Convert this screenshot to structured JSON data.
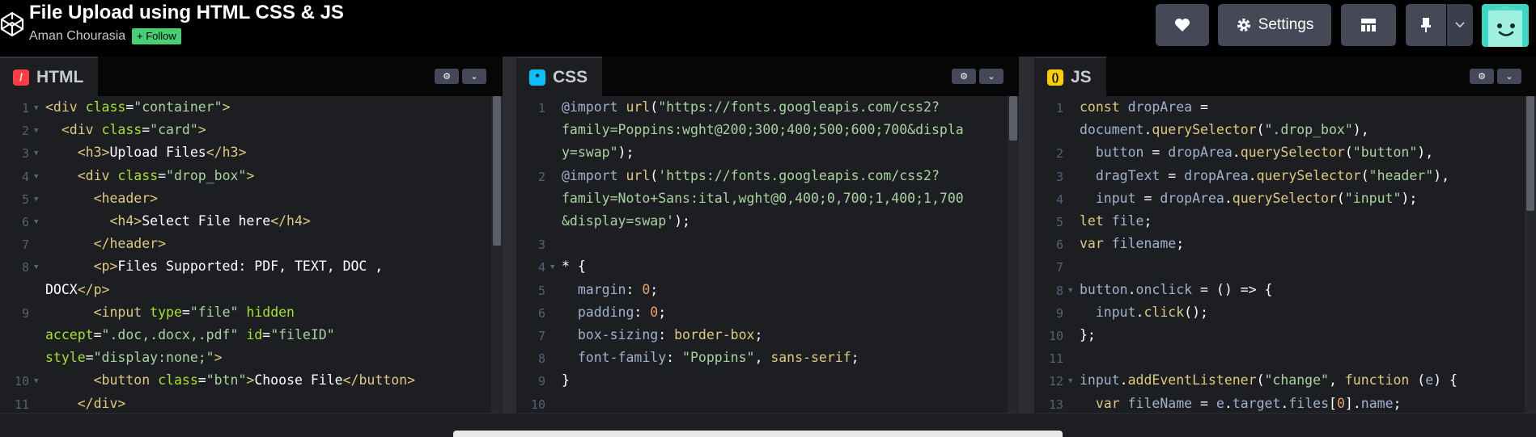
{
  "header": {
    "title": "File Upload using HTML CSS & JS",
    "author": "Aman Chourasia",
    "follow_label": "+ Follow",
    "settings_label": "Settings",
    "icons": [
      "codepen-logo-icon",
      "heart-icon",
      "gear-icon",
      "layout-icon",
      "pin-icon",
      "chevron-down-icon",
      "avatar"
    ]
  },
  "panels": {
    "html": {
      "label": "HTML",
      "lines": [
        {
          "n": "1",
          "fold": true,
          "segs": [
            [
              "t-tag",
              "<div "
            ],
            [
              "t-attr",
              "class"
            ],
            [
              "",
              "="
            ],
            [
              "t-str",
              "\"container\""
            ],
            [
              "t-tag",
              ">"
            ]
          ]
        },
        {
          "n": "2",
          "fold": true,
          "segs": [
            [
              "",
              "  "
            ],
            [
              "t-tag",
              "<div "
            ],
            [
              "t-attr",
              "class"
            ],
            [
              "",
              "="
            ],
            [
              "t-str",
              "\"card\""
            ],
            [
              "t-tag",
              ">"
            ]
          ]
        },
        {
          "n": "3",
          "fold": true,
          "segs": [
            [
              "",
              "    "
            ],
            [
              "t-tag",
              "<h3>"
            ],
            [
              "",
              "Upload Files"
            ],
            [
              "t-tag",
              "</h3>"
            ]
          ]
        },
        {
          "n": "4",
          "fold": true,
          "segs": [
            [
              "",
              "    "
            ],
            [
              "t-tag",
              "<div "
            ],
            [
              "t-attr",
              "class"
            ],
            [
              "",
              "="
            ],
            [
              "t-str",
              "\"drop_box\""
            ],
            [
              "t-tag",
              ">"
            ]
          ]
        },
        {
          "n": "5",
          "fold": true,
          "segs": [
            [
              "",
              "      "
            ],
            [
              "t-tag",
              "<header>"
            ]
          ]
        },
        {
          "n": "6",
          "fold": true,
          "segs": [
            [
              "",
              "        "
            ],
            [
              "t-tag",
              "<h4>"
            ],
            [
              "",
              "Select File here"
            ],
            [
              "t-tag",
              "</h4>"
            ]
          ]
        },
        {
          "n": "7",
          "fold": false,
          "segs": [
            [
              "",
              "      "
            ],
            [
              "t-tag",
              "</header>"
            ]
          ]
        },
        {
          "n": "8",
          "fold": true,
          "segs": [
            [
              "",
              "      "
            ],
            [
              "t-tag",
              "<p>"
            ],
            [
              "",
              "Files Supported: PDF, TEXT, DOC ,"
            ]
          ]
        },
        {
          "n": "",
          "fold": false,
          "segs": [
            [
              "",
              "DOCX"
            ],
            [
              "t-tag",
              "</p>"
            ]
          ]
        },
        {
          "n": "9",
          "fold": false,
          "segs": [
            [
              "",
              "      "
            ],
            [
              "t-tag",
              "<input "
            ],
            [
              "t-attr",
              "type"
            ],
            [
              "",
              "="
            ],
            [
              "t-str",
              "\"file\""
            ],
            [
              "",
              ""
            ],
            [
              "t-attr",
              " hidden"
            ]
          ]
        },
        {
          "n": "",
          "fold": false,
          "segs": [
            [
              "t-attr",
              "accept"
            ],
            [
              "",
              "="
            ],
            [
              "t-str",
              "\".doc,.docx,.pdf\""
            ],
            [
              "t-attr",
              " id"
            ],
            [
              "",
              "="
            ],
            [
              "t-str",
              "\"fileID\""
            ]
          ]
        },
        {
          "n": "",
          "fold": false,
          "segs": [
            [
              "t-attr",
              "style"
            ],
            [
              "",
              "="
            ],
            [
              "t-str",
              "\"display:none;\""
            ],
            [
              "t-tag",
              ">"
            ]
          ]
        },
        {
          "n": "10",
          "fold": true,
          "segs": [
            [
              "",
              "      "
            ],
            [
              "t-tag",
              "<button "
            ],
            [
              "t-attr",
              "class"
            ],
            [
              "",
              "="
            ],
            [
              "t-str",
              "\"btn\""
            ],
            [
              "t-tag",
              ">"
            ],
            [
              "",
              "Choose File"
            ],
            [
              "t-tag",
              "</button>"
            ]
          ]
        },
        {
          "n": "11",
          "fold": false,
          "segs": [
            [
              "",
              "    "
            ],
            [
              "t-tag",
              "</div>"
            ]
          ]
        }
      ]
    },
    "css": {
      "label": "CSS",
      "lines": [
        {
          "n": "1",
          "fold": false,
          "segs": [
            [
              "t-at",
              "@import "
            ],
            [
              "t-fn",
              "url"
            ],
            [
              "",
              "("
            ],
            [
              "t-str",
              "\"https://fonts.googleapis.com/css2?"
            ]
          ]
        },
        {
          "n": "",
          "fold": false,
          "segs": [
            [
              "t-str",
              "family=Poppins:wght@200;300;400;500;600;700&displa"
            ]
          ]
        },
        {
          "n": "",
          "fold": false,
          "segs": [
            [
              "t-str",
              "y=swap\""
            ],
            [
              "",
              ");"
            ]
          ]
        },
        {
          "n": "2",
          "fold": false,
          "segs": [
            [
              "t-at",
              "@import "
            ],
            [
              "t-fn",
              "url"
            ],
            [
              "",
              "("
            ],
            [
              "t-str",
              "'https://fonts.googleapis.com/css2?"
            ]
          ]
        },
        {
          "n": "",
          "fold": false,
          "segs": [
            [
              "t-str",
              "family=Noto+Sans:ital,wght@0,400;0,700;1,400;1,700"
            ]
          ]
        },
        {
          "n": "",
          "fold": false,
          "segs": [
            [
              "t-str",
              "&display=swap'"
            ],
            [
              "",
              ");"
            ]
          ]
        },
        {
          "n": "3",
          "fold": false,
          "segs": []
        },
        {
          "n": "4",
          "fold": true,
          "segs": [
            [
              "",
              "* {"
            ]
          ]
        },
        {
          "n": "5",
          "fold": false,
          "segs": [
            [
              "",
              "  "
            ],
            [
              "t-prop",
              "margin"
            ],
            [
              "",
              ": "
            ],
            [
              "t-num",
              "0"
            ],
            [
              "",
              ";"
            ]
          ]
        },
        {
          "n": "6",
          "fold": false,
          "segs": [
            [
              "",
              "  "
            ],
            [
              "t-prop",
              "padding"
            ],
            [
              "",
              ": "
            ],
            [
              "t-num",
              "0"
            ],
            [
              "",
              ";"
            ]
          ]
        },
        {
          "n": "7",
          "fold": false,
          "segs": [
            [
              "",
              "  "
            ],
            [
              "t-prop",
              "box-sizing"
            ],
            [
              "",
              ": "
            ],
            [
              "t-val",
              "border-box"
            ],
            [
              "",
              ";"
            ]
          ]
        },
        {
          "n": "8",
          "fold": false,
          "segs": [
            [
              "",
              "  "
            ],
            [
              "t-prop",
              "font-family"
            ],
            [
              "",
              ": "
            ],
            [
              "t-str",
              "\"Poppins\""
            ],
            [
              "",
              ", "
            ],
            [
              "t-val",
              "sans-serif"
            ],
            [
              "",
              ";"
            ]
          ]
        },
        {
          "n": "9",
          "fold": false,
          "segs": [
            [
              "",
              "}"
            ]
          ]
        },
        {
          "n": "10",
          "fold": false,
          "segs": []
        }
      ]
    },
    "js": {
      "label": "JS",
      "lines": [
        {
          "n": "1",
          "fold": false,
          "segs": [
            [
              "t-kw",
              "const "
            ],
            [
              "t-var",
              "dropArea"
            ],
            [
              "",
              " ="
            ]
          ]
        },
        {
          "n": "",
          "fold": false,
          "segs": [
            [
              "t-var",
              "document"
            ],
            [
              "",
              "."
            ],
            [
              "t-fn",
              "querySelector"
            ],
            [
              "",
              "("
            ],
            [
              "t-str",
              "\".drop_box\""
            ],
            [
              "",
              "),"
            ]
          ]
        },
        {
          "n": "2",
          "fold": false,
          "segs": [
            [
              "",
              "  "
            ],
            [
              "t-var",
              "button"
            ],
            [
              "",
              " = "
            ],
            [
              "t-var",
              "dropArea"
            ],
            [
              "",
              "."
            ],
            [
              "t-fn",
              "querySelector"
            ],
            [
              "",
              "("
            ],
            [
              "t-str",
              "\"button\""
            ],
            [
              "",
              "),"
            ]
          ]
        },
        {
          "n": "3",
          "fold": false,
          "segs": [
            [
              "",
              "  "
            ],
            [
              "t-var",
              "dragText"
            ],
            [
              "",
              " = "
            ],
            [
              "t-var",
              "dropArea"
            ],
            [
              "",
              "."
            ],
            [
              "t-fn",
              "querySelector"
            ],
            [
              "",
              "("
            ],
            [
              "t-str",
              "\"header\""
            ],
            [
              "",
              "),"
            ]
          ]
        },
        {
          "n": "4",
          "fold": false,
          "segs": [
            [
              "",
              "  "
            ],
            [
              "t-var",
              "input"
            ],
            [
              "",
              " = "
            ],
            [
              "t-var",
              "dropArea"
            ],
            [
              "",
              "."
            ],
            [
              "t-fn",
              "querySelector"
            ],
            [
              "",
              "("
            ],
            [
              "t-str",
              "\"input\""
            ],
            [
              "",
              ");"
            ]
          ]
        },
        {
          "n": "5",
          "fold": false,
          "segs": [
            [
              "t-kw",
              "let "
            ],
            [
              "t-var",
              "file"
            ],
            [
              "",
              ";"
            ]
          ]
        },
        {
          "n": "6",
          "fold": false,
          "segs": [
            [
              "t-kw",
              "var "
            ],
            [
              "t-var",
              "filename"
            ],
            [
              "",
              ";"
            ]
          ]
        },
        {
          "n": "7",
          "fold": false,
          "segs": []
        },
        {
          "n": "8",
          "fold": true,
          "segs": [
            [
              "t-var",
              "button"
            ],
            [
              "",
              "."
            ],
            [
              "t-var",
              "onclick"
            ],
            [
              "",
              " = () => {"
            ]
          ]
        },
        {
          "n": "9",
          "fold": false,
          "segs": [
            [
              "",
              "  "
            ],
            [
              "t-var",
              "input"
            ],
            [
              "",
              "."
            ],
            [
              "t-fn",
              "click"
            ],
            [
              "",
              "();"
            ]
          ]
        },
        {
          "n": "10",
          "fold": false,
          "segs": [
            [
              "",
              "};"
            ]
          ]
        },
        {
          "n": "11",
          "fold": false,
          "segs": []
        },
        {
          "n": "12",
          "fold": true,
          "segs": [
            [
              "t-var",
              "input"
            ],
            [
              "",
              "."
            ],
            [
              "t-fn",
              "addEventListener"
            ],
            [
              "",
              "("
            ],
            [
              "t-str",
              "\"change\""
            ],
            [
              "",
              ", "
            ],
            [
              "t-kw",
              "function"
            ],
            [
              "",
              " ("
            ],
            [
              "t-var",
              "e"
            ],
            [
              "",
              ") {"
            ]
          ]
        },
        {
          "n": "13",
          "fold": false,
          "segs": [
            [
              "",
              "  "
            ],
            [
              "t-kw",
              "var "
            ],
            [
              "t-var",
              "fileName"
            ],
            [
              "",
              " = "
            ],
            [
              "t-var",
              "e"
            ],
            [
              "",
              "."
            ],
            [
              "t-var",
              "target"
            ],
            [
              "",
              "."
            ],
            [
              "t-var",
              "files"
            ],
            [
              "",
              "["
            ],
            [
              "t-num",
              "0"
            ],
            [
              "",
              "]."
            ],
            [
              "t-var",
              "name"
            ],
            [
              "",
              ";"
            ]
          ]
        }
      ]
    }
  }
}
